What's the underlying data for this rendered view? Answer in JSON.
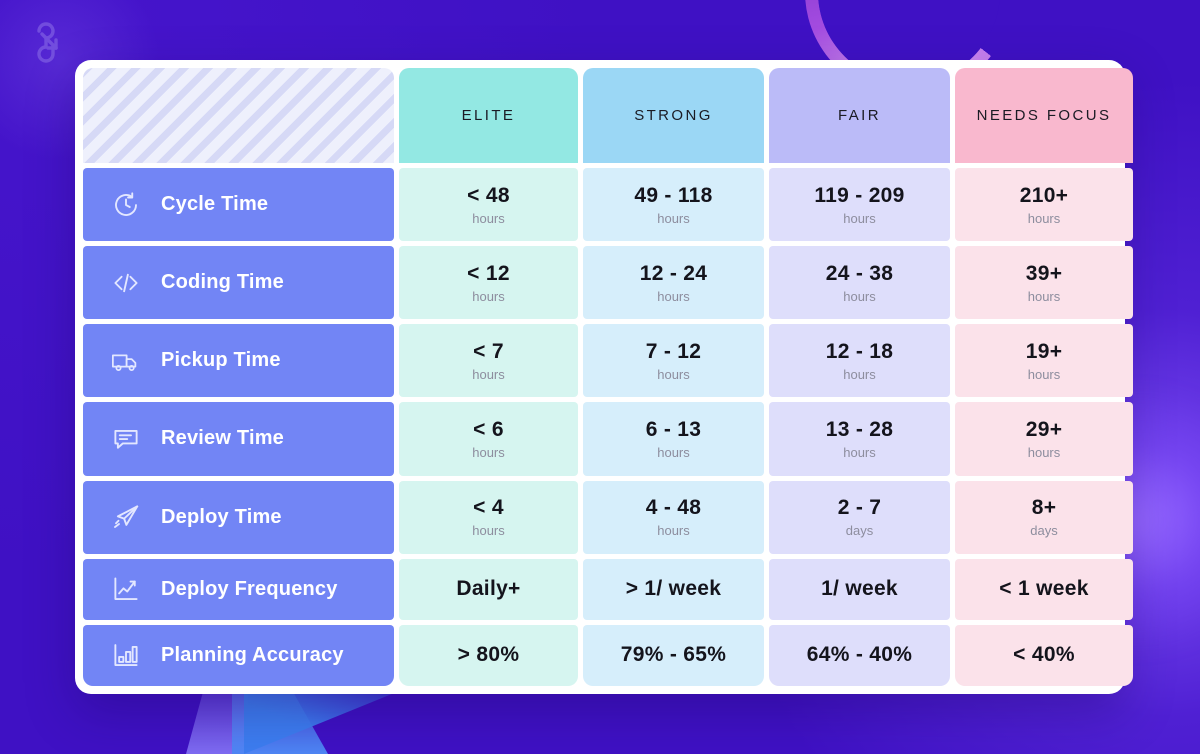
{
  "brand": {
    "logo_name": "linked-arrows-logo"
  },
  "colors": {
    "page_background": "#3F11C4",
    "card_background": "#FFFFFF",
    "row_label": "#7285F5",
    "elite_header": "#93E8E3",
    "strong_header": "#9BD7F5",
    "fair_header": "#BBBBF8",
    "needs_focus_header": "#F9B8CE",
    "elite_cell": "#D6F5F0",
    "strong_cell": "#D6EEFB",
    "fair_cell": "#DEDEFB",
    "needs_focus_cell": "#FBE2EA"
  },
  "table": {
    "corner_label": "",
    "columns": [
      {
        "key": "elite",
        "label": "ELITE",
        "header_color": "#93E8E3",
        "cell_color": "#D6F5F0"
      },
      {
        "key": "strong",
        "label": "STRONG",
        "header_color": "#9BD7F5",
        "cell_color": "#D6EEFB"
      },
      {
        "key": "fair",
        "label": "FAIR",
        "header_color": "#BBBBF8",
        "cell_color": "#DEDEFB"
      },
      {
        "key": "needs_focus",
        "label": "NEEDS FOCUS",
        "header_color": "#F9B8CE",
        "cell_color": "#FBE2EA"
      }
    ],
    "rows": [
      {
        "label": "Cycle Time",
        "icon": "cycle-clock-icon",
        "cells": [
          {
            "value": "< 48",
            "unit": "hours"
          },
          {
            "value": "49 - 118",
            "unit": "hours"
          },
          {
            "value": "119 - 209",
            "unit": "hours"
          },
          {
            "value": "210+",
            "unit": "hours"
          }
        ]
      },
      {
        "label": "Coding Time",
        "icon": "code-brackets-icon",
        "cells": [
          {
            "value": "< 12",
            "unit": "hours"
          },
          {
            "value": "12 - 24",
            "unit": "hours"
          },
          {
            "value": "24 - 38",
            "unit": "hours"
          },
          {
            "value": "39+",
            "unit": "hours"
          }
        ]
      },
      {
        "label": "Pickup Time",
        "icon": "delivery-truck-icon",
        "cells": [
          {
            "value": "< 7",
            "unit": "hours"
          },
          {
            "value": "7 - 12",
            "unit": "hours"
          },
          {
            "value": "12 - 18",
            "unit": "hours"
          },
          {
            "value": "19+",
            "unit": "hours"
          }
        ]
      },
      {
        "label": "Review Time",
        "icon": "comment-bubble-icon",
        "cells": [
          {
            "value": "< 6",
            "unit": "hours"
          },
          {
            "value": "6 - 13",
            "unit": "hours"
          },
          {
            "value": "13 - 28",
            "unit": "hours"
          },
          {
            "value": "29+",
            "unit": "hours"
          }
        ]
      },
      {
        "label": "Deploy Time",
        "icon": "paper-plane-icon",
        "cells": [
          {
            "value": "< 4",
            "unit": "hours"
          },
          {
            "value": "4 - 48",
            "unit": "hours"
          },
          {
            "value": "2 - 7",
            "unit": "days"
          },
          {
            "value": "8+",
            "unit": "days"
          }
        ]
      },
      {
        "label": "Deploy Frequency",
        "icon": "line-chart-icon",
        "cells": [
          {
            "value": "Daily+",
            "unit": ""
          },
          {
            "value": "> 1/ week",
            "unit": ""
          },
          {
            "value": "1/ week",
            "unit": ""
          },
          {
            "value": "< 1 week",
            "unit": ""
          }
        ]
      },
      {
        "label": "Planning Accuracy",
        "icon": "bar-chart-icon",
        "cells": [
          {
            "value": "> 80%",
            "unit": ""
          },
          {
            "value": "79% - 65%",
            "unit": ""
          },
          {
            "value": "64% - 40%",
            "unit": ""
          },
          {
            "value": "< 40%",
            "unit": ""
          }
        ]
      }
    ]
  }
}
